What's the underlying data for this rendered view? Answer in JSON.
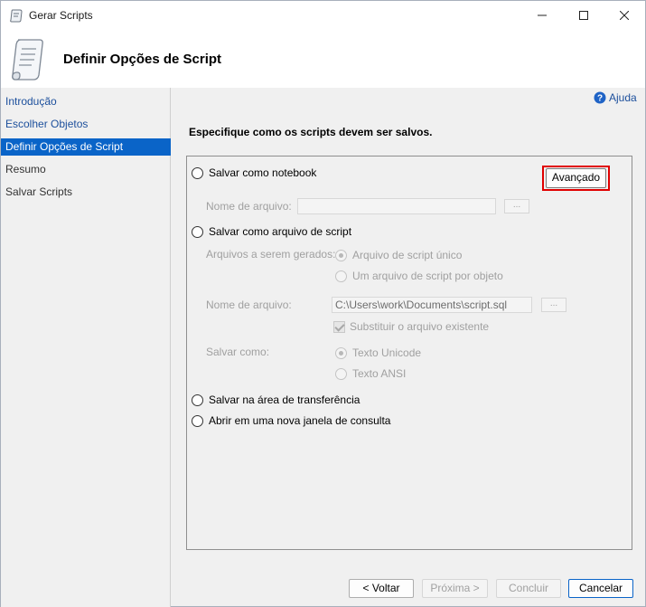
{
  "window": {
    "title": "Gerar Scripts"
  },
  "header": {
    "title": "Definir Opções de Script"
  },
  "sidebar": {
    "items": [
      {
        "label": "Introdução"
      },
      {
        "label": "Escolher Objetos"
      },
      {
        "label": "Definir Opções de Script"
      },
      {
        "label": "Resumo"
      },
      {
        "label": "Salvar Scripts"
      }
    ]
  },
  "help": {
    "label": "Ajuda"
  },
  "main": {
    "instruction": "Especifique como os scripts devem ser salvos.",
    "notebook": {
      "option_label": "Salvar como notebook",
      "filename_label": "Nome de arquivo:",
      "filename_value": "",
      "browse_label": "..."
    },
    "advanced_label": "Avançado",
    "script_file": {
      "option_label": "Salvar como arquivo de script",
      "files_label": "Arquivos a serem gerados:",
      "single_file_label": "Arquivo de script único",
      "per_object_label": "Um arquivo de script por objeto",
      "filename_label": "Nome de arquivo:",
      "filename_value": "C:\\Users\\work\\Documents\\script.sql",
      "browse_label": "...",
      "overwrite_label": "Substituir o arquivo existente",
      "save_as_label": "Salvar como:",
      "unicode_label": "Texto Unicode",
      "ansi_label": "Texto ANSI"
    },
    "clipboard_label": "Salvar na área de transferência",
    "query_window_label": "Abrir em uma nova janela de consulta"
  },
  "footer": {
    "back_label": "< Voltar",
    "next_label": "Próxima >",
    "finish_label": "Concluir",
    "cancel_label": "Cancelar"
  },
  "colors": {
    "accent": "#0a64c8",
    "link": "#1c4f9c",
    "highlight": "#e00000"
  }
}
